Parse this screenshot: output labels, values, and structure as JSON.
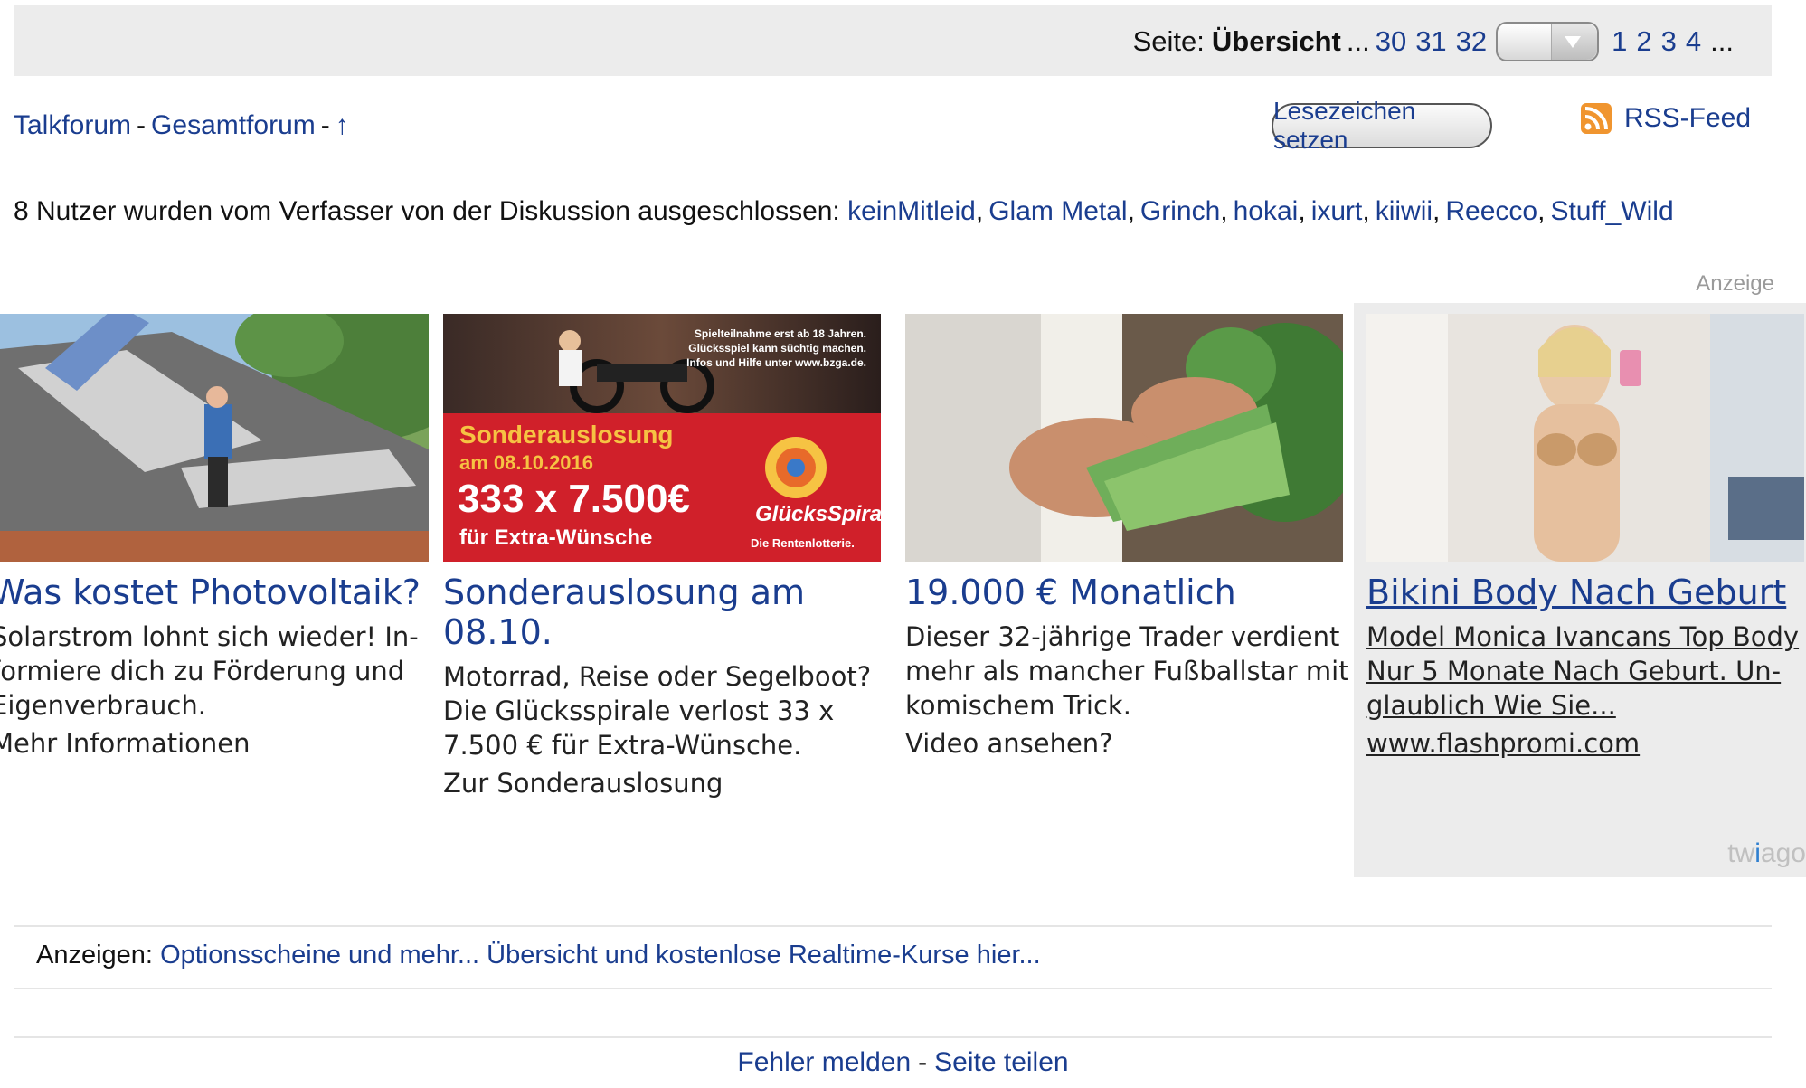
{
  "pager": {
    "label": "Seite:",
    "overview": "Übersicht",
    "ellipsis_before": "...",
    "recent_pages": [
      "30",
      "31",
      "32"
    ],
    "first_pages": [
      "1",
      "2",
      "3",
      "4"
    ],
    "ellipsis_after": "..."
  },
  "breadcrumb": {
    "forum": "Talkforum",
    "sep": "-",
    "section": "Gesamtforum",
    "up_arrow": "↑"
  },
  "bookmark_button": "Lesezeichen setzen",
  "rss": {
    "label": "RSS-Feed",
    "color": "#f0952f"
  },
  "excluded": {
    "text": "8 Nutzer wurden vom Verfasser von der Diskussion ausgeschlossen:",
    "users": [
      "keinMitleid",
      "Glam Metal",
      "Grinch",
      "hokai",
      "ixurt",
      "kiiwii",
      "Reecco",
      "Stuff_Wild"
    ]
  },
  "ads": {
    "tag": "Anzeige",
    "items": [
      {
        "title": "Was kostet Photovoltaik?",
        "lines": [
          "Solarstrom lohnt sich wieder! In-",
          "formiere dich zu Förderung und",
          "Eigenverbrauch."
        ],
        "cta": "Mehr Informationen"
      },
      {
        "title_lines": [
          "Sonderauslosung am",
          "08.10."
        ],
        "lines": [
          "Motorrad, Reise oder Segelboot?",
          "Die Glücksspirale verlost 33 x",
          "7.500 € für Extra-Wünsche."
        ],
        "cta": "Zur Sonderauslosung",
        "image_text": {
          "notice_lines": [
            "Spielteilnahme erst ab 18 Jahren.",
            "Glücksspiel kann süchtig machen.",
            "Infos und Hilfe unter www.bzga.de."
          ],
          "headline": "Sonderauslosung",
          "date": "am 08.10.2016",
          "amount": "333 x 7.500€",
          "tagline": "für Extra-Wünsche",
          "brand": "GlücksSpirale",
          "brand_sub": "Die Rentenlotterie."
        }
      },
      {
        "title": "19.000 € Monatlich",
        "lines": [
          "Dieser 32-jährige Trader verdient",
          "mehr als mancher Fußballstar mit",
          "komischem Trick."
        ],
        "cta": "Video ansehen?"
      },
      {
        "title": "Bikini Body Nach Geburt",
        "lines": [
          "Model Monica Ivancans Top Body",
          "Nur 5 Monate Nach Geburt. Un-",
          "glaublich Wie Sie..."
        ],
        "cta": "www.flashpromi.com"
      }
    ],
    "network_logo": "twiago"
  },
  "anzeigen_row": {
    "label": "Anzeigen:",
    "link": "Optionsscheine und mehr... Übersicht und kostenlose Realtime-Kurse hier..."
  },
  "footer": {
    "report": "Fehler melden",
    "sep": "-",
    "share": "Seite teilen"
  },
  "colors": {
    "link": "#1a3d8f",
    "bar_bg": "#ececec",
    "ad_red": "#d0202a",
    "ad_yellow": "#f6c343"
  }
}
